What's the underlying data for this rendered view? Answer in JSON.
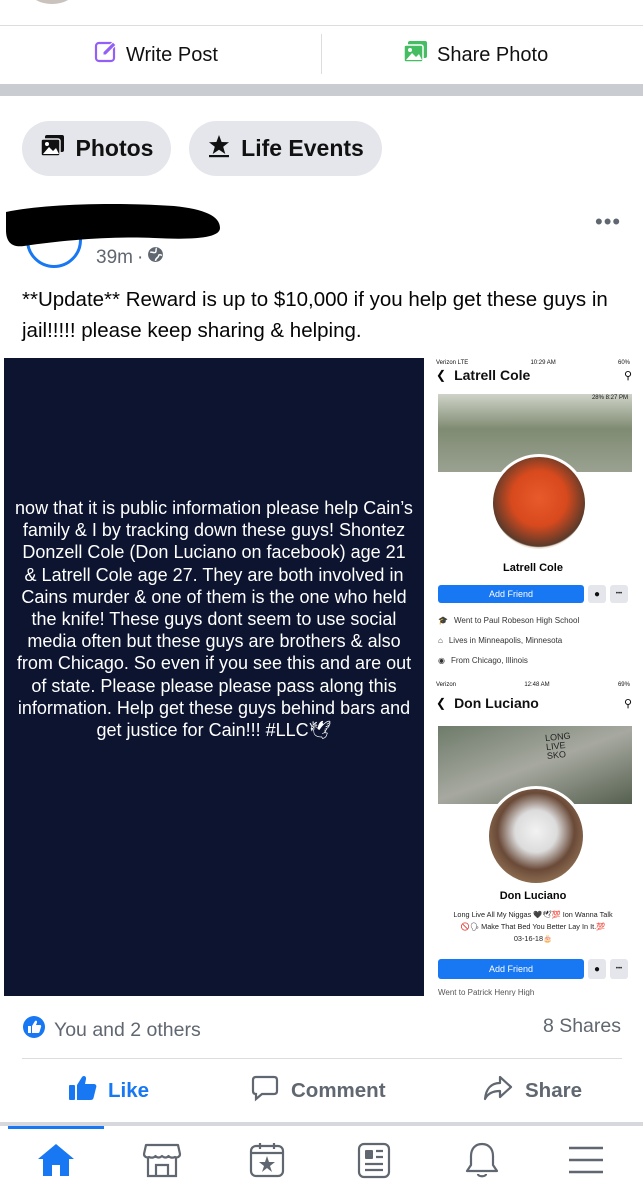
{
  "composer": {
    "write_post_label": "Write Post",
    "share_photo_label": "Share Photo"
  },
  "profile_pills": {
    "photos_label": "Photos",
    "life_events_label": "Life Events"
  },
  "post": {
    "time": "39m",
    "separator": "·",
    "more_label": "•••",
    "text": "**Update** Reward is up to $10,000 if you help get these guys in jail!!!!! please keep sharing & helping.",
    "image_left": {
      "text": "now that it is public information please help Cain’s family & I by tracking down these guys! Shontez Donzell Cole (Don Luciano on facebook) age 21 & Latrell Cole age 27. They are both involved in Cains murder & one of them is the one who held the knife! These guys dont seem to use social media often but these guys are brothers & also from Chicago. So even if you see this and are out of state. Please please please pass along this information. Help get these guys behind bars and get justice for Cain!!! #LLC🕊"
    },
    "image_right": {
      "profile1": {
        "status_carrier": "Verizon  LTE",
        "status_time": "10:29 AM",
        "status_batt": "60%",
        "header_name": "Latrell Cole",
        "inner_status": "28% 8:27 PM",
        "name": "Latrell Cole",
        "add_friend": "Add Friend",
        "more": "•••",
        "info": [
          "Went to Paul Robeson High School",
          "Lives in Minneapolis, Minnesota",
          "From Chicago, Illinois"
        ]
      },
      "profile2": {
        "status_carrier": "Verizon",
        "status_time": "12:48 AM",
        "status_batt": "69%",
        "header_name": "Don Luciano",
        "cover_sign": "LONG LIVE SKO",
        "name": "Don Luciano",
        "bio_line1": "Long Live All My Niggas 🖤🕊💯 Ion Wanna Talk",
        "bio_line2": "🚫🗣 Make That Bed You Better Lay In It.💯",
        "bio_line3": "03-16-18🎂",
        "add_friend": "Add Friend",
        "more": "•••",
        "info_cut": "Went to Patrick Henry High"
      }
    },
    "reactions_text": "You and 2 others",
    "shares_text": "8 Shares",
    "actions": {
      "like": "Like",
      "comment": "Comment",
      "share": "Share"
    }
  },
  "colors": {
    "fb_blue": "#1877f2",
    "gray_text": "#606770",
    "pill_bg": "#e4e6eb",
    "share_photo_green": "#45bd62",
    "write_post_purple": "#9360f7"
  },
  "tabs": [
    "home-icon",
    "marketplace-icon",
    "pages-icon",
    "news-icon",
    "bell-icon",
    "menu-icon"
  ]
}
